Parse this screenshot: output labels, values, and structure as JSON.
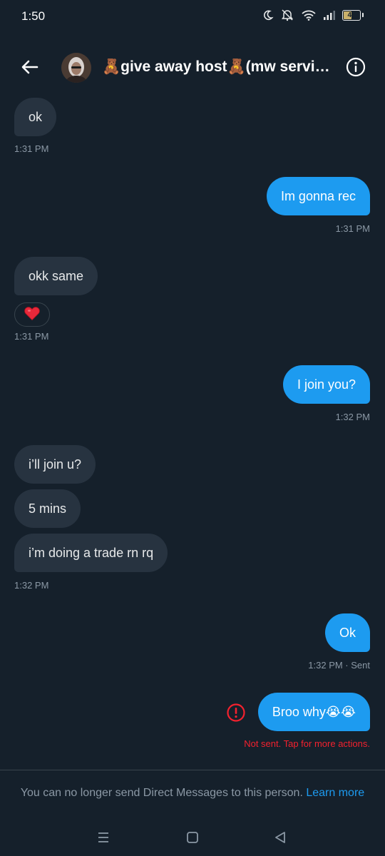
{
  "status_bar": {
    "time": "1:50",
    "battery": "47",
    "battery_level": 0.47,
    "icons": [
      "moon-icon",
      "mute-icon",
      "wifi-icon",
      "signal-icon",
      "battery-icon"
    ]
  },
  "header": {
    "title": "🧸give away host🧸(mw service o...",
    "back_icon": "arrow-left-icon",
    "info_icon": "info-icon"
  },
  "messages": [
    {
      "direction": "in",
      "text": "ok",
      "time": "1:31 PM"
    },
    {
      "direction": "out",
      "text": "Im gonna rec",
      "time": "1:31 PM"
    },
    {
      "direction": "in",
      "text": "okk same",
      "reaction": "❤️",
      "time": "1:31 PM"
    },
    {
      "direction": "out",
      "text": "I join you?",
      "time": "1:32 PM"
    },
    {
      "direction": "in",
      "text": "i’ll join u?"
    },
    {
      "direction": "in",
      "text": "5 mins"
    },
    {
      "direction": "in",
      "text": "i’m doing a trade rn rq",
      "time": "1:32 PM"
    },
    {
      "direction": "out",
      "text": "Ok",
      "time": "1:32 PM · Sent"
    },
    {
      "direction": "out",
      "text": "Broo why😭😭",
      "error": "Not sent. Tap for more actions."
    }
  ],
  "footer": {
    "notice": "You can no longer send Direct Messages to this person.",
    "link": "Learn more"
  },
  "colors": {
    "background": "#15202b",
    "incoming_bubble": "#273340",
    "outgoing_bubble": "#1d9bf0",
    "error": "#f4212e",
    "muted_text": "#8b98a5"
  }
}
